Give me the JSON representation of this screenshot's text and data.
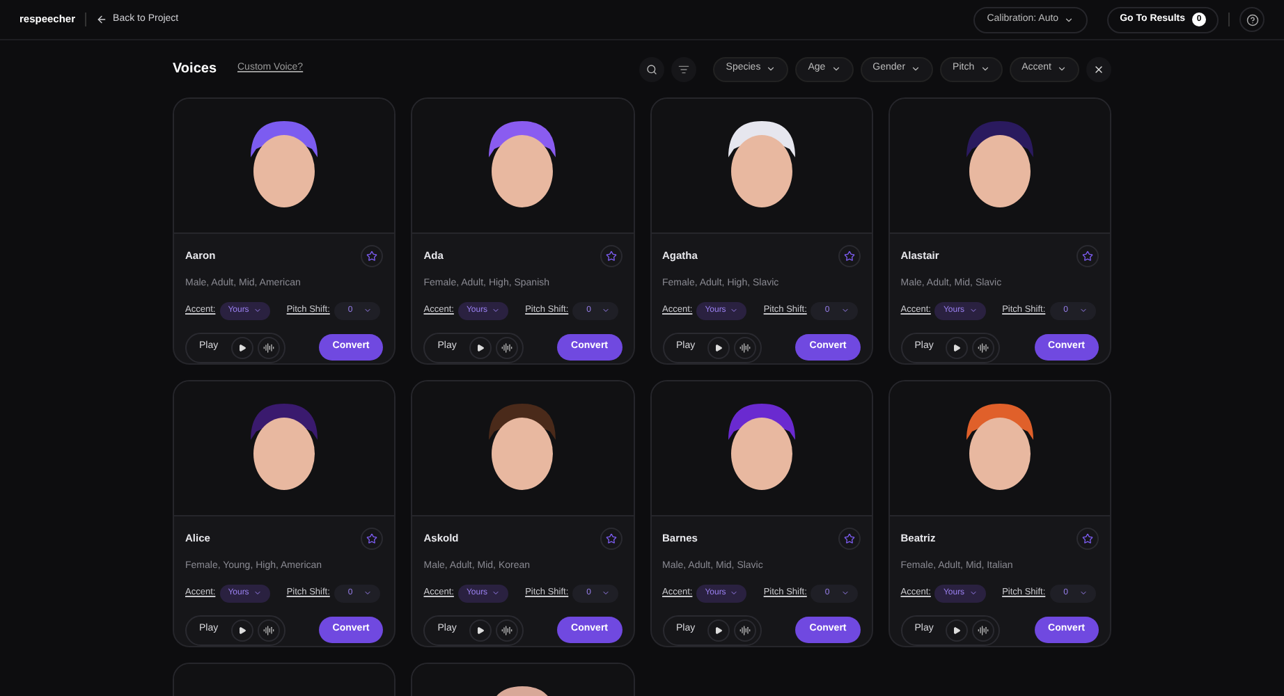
{
  "header": {
    "logo": "respeecher",
    "back": "Back to Project",
    "calibration": "Calibration: Auto",
    "results": "Go To Results",
    "results_count": "0"
  },
  "title": "Voices",
  "custom_link": "Custom Voice?",
  "filters": [
    "Species",
    "Age",
    "Gender",
    "Pitch",
    "Accent"
  ],
  "voices": [
    {
      "kind": "card",
      "name": "Aaron",
      "desc": "Male, Adult, Mid, American",
      "favorite": false,
      "accent_label": "Accent:",
      "accent": "Yours",
      "pitch_label": "Pitch Shift:",
      "pitch": "0",
      "play": "Play",
      "convert": "Convert",
      "color": "#7c5cf0"
    },
    {
      "kind": "card",
      "name": "Ada",
      "desc": "Female, Adult, High, Spanish",
      "favorite": false,
      "accent_label": "Accent:",
      "accent": "Yours",
      "pitch_label": "Pitch Shift:",
      "pitch": "0",
      "play": "Play",
      "convert": "Convert",
      "color": "#8a5cf0"
    },
    {
      "kind": "card",
      "name": "Agatha",
      "desc": "Female, Adult, High, Slavic",
      "favorite": false,
      "accent_label": "Accent:",
      "accent": "Yours",
      "pitch_label": "Pitch Shift:",
      "pitch": "0",
      "play": "Play",
      "convert": "Convert",
      "color": "#e6e6ee"
    },
    {
      "kind": "card",
      "name": "Alastair",
      "desc": "Male, Adult, Mid, Slavic",
      "favorite": false,
      "accent_label": "Accent:",
      "accent": "Yours",
      "pitch_label": "Pitch Shift:",
      "pitch": "0",
      "play": "Play",
      "convert": "Convert",
      "color": "#2a1a5e"
    },
    {
      "kind": "card",
      "name": "Alice",
      "desc": "Female, Young, High, American",
      "favorite": false,
      "accent_label": "Accent:",
      "accent": "Yours",
      "pitch_label": "Pitch Shift:",
      "pitch": "0",
      "play": "Play",
      "convert": "Convert",
      "color": "#3a1a6e"
    },
    {
      "kind": "card",
      "name": "Askold",
      "desc": "Male, Adult, Mid, Korean",
      "favorite": false,
      "accent_label": "Accent:",
      "accent": "Yours",
      "pitch_label": "Pitch Shift:",
      "pitch": "0",
      "play": "Play",
      "convert": "Convert",
      "color": "#4a2a1a"
    },
    {
      "kind": "card",
      "name": "Barnes",
      "desc": "Male, Adult, Mid, Slavic",
      "favorite": false,
      "accent_label": "Accent:",
      "accent": "Yours",
      "pitch_label": "Pitch Shift:",
      "pitch": "0",
      "play": "Play",
      "convert": "Convert",
      "color": "#6a2ad0"
    },
    {
      "kind": "card",
      "name": "Beatriz",
      "desc": "Female, Adult, Mid, Italian",
      "favorite": false,
      "accent_label": "Accent:",
      "accent": "Yours",
      "pitch_label": "Pitch Shift:",
      "pitch": "0",
      "play": "Play",
      "convert": "Convert",
      "color": "#e0602a"
    },
    {
      "kind": "cut_off"
    },
    {
      "kind": "cut_off",
      "color": "#d8a898"
    }
  ]
}
